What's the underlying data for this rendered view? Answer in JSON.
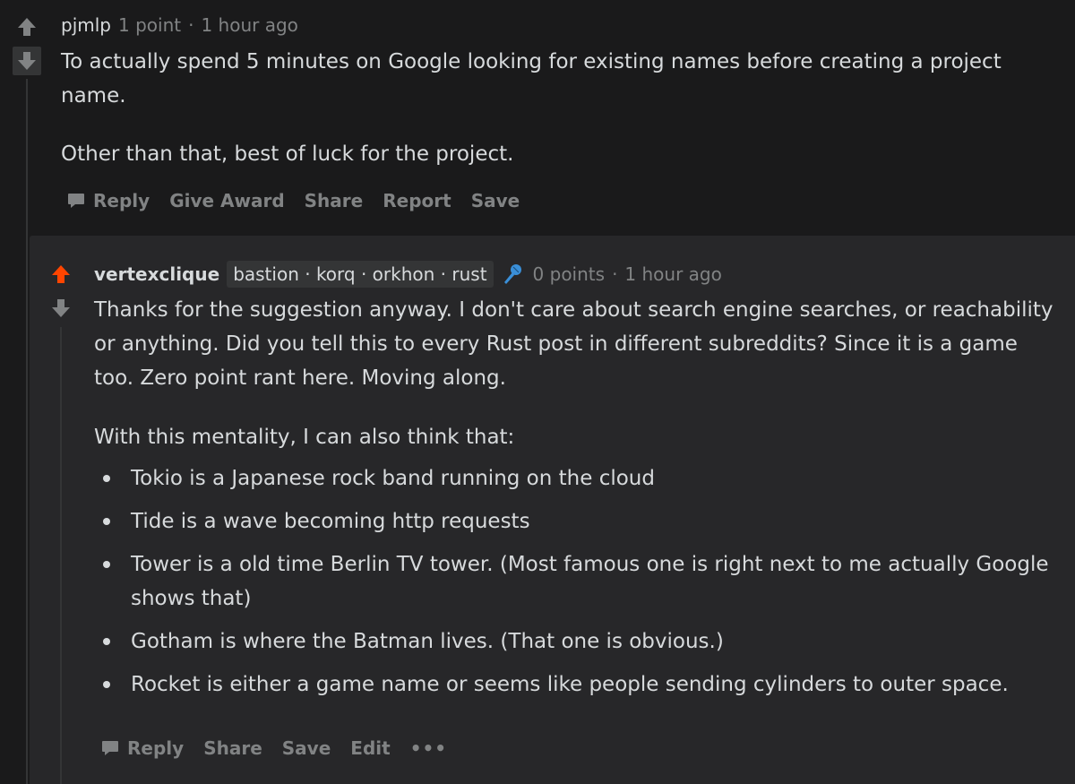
{
  "colors": {
    "background": "#1a1a1b",
    "reply_background": "#272729",
    "text": "#d7dadc",
    "muted": "#818384",
    "upvote_active": "#ff4500",
    "mic_blue": "#3a8fd8"
  },
  "comment": {
    "author": "pjmlp",
    "points": "1 point",
    "separator": "·",
    "time": "1 hour ago",
    "paragraphs": [
      "To actually spend 5 minutes on Google looking for existing names before creating a project name.",
      "Other than that, best of luck for the project."
    ],
    "actions": {
      "reply": "Reply",
      "give_award": "Give Award",
      "share": "Share",
      "report": "Report",
      "save": "Save"
    }
  },
  "reply": {
    "author": "vertexclique",
    "flair": "bastion · korq · orkhon · rust",
    "flair_icon": "microphone-icon",
    "points": "0 points",
    "separator": "·",
    "time": "1 hour ago",
    "upvoted": true,
    "paragraphs": [
      "Thanks for the suggestion anyway. I don't care about search engine searches, or reachability or anything. Did you tell this to every Rust post in different subreddits? Since it is a game too. Zero point rant here. Moving along.",
      "With this mentality, I can also think that:"
    ],
    "bullets": [
      "Tokio is a Japanese rock band running on the cloud",
      "Tide is a wave becoming http requests",
      "Tower is a old time Berlin TV tower. (Most famous one is right next to me actually Google shows that)",
      "Gotham is where the Batman lives. (That one is obvious.)",
      "Rocket is either a game name or seems like people sending cylinders to outer space."
    ],
    "actions": {
      "reply": "Reply",
      "share": "Share",
      "save": "Save",
      "edit": "Edit",
      "more": "•••"
    }
  }
}
